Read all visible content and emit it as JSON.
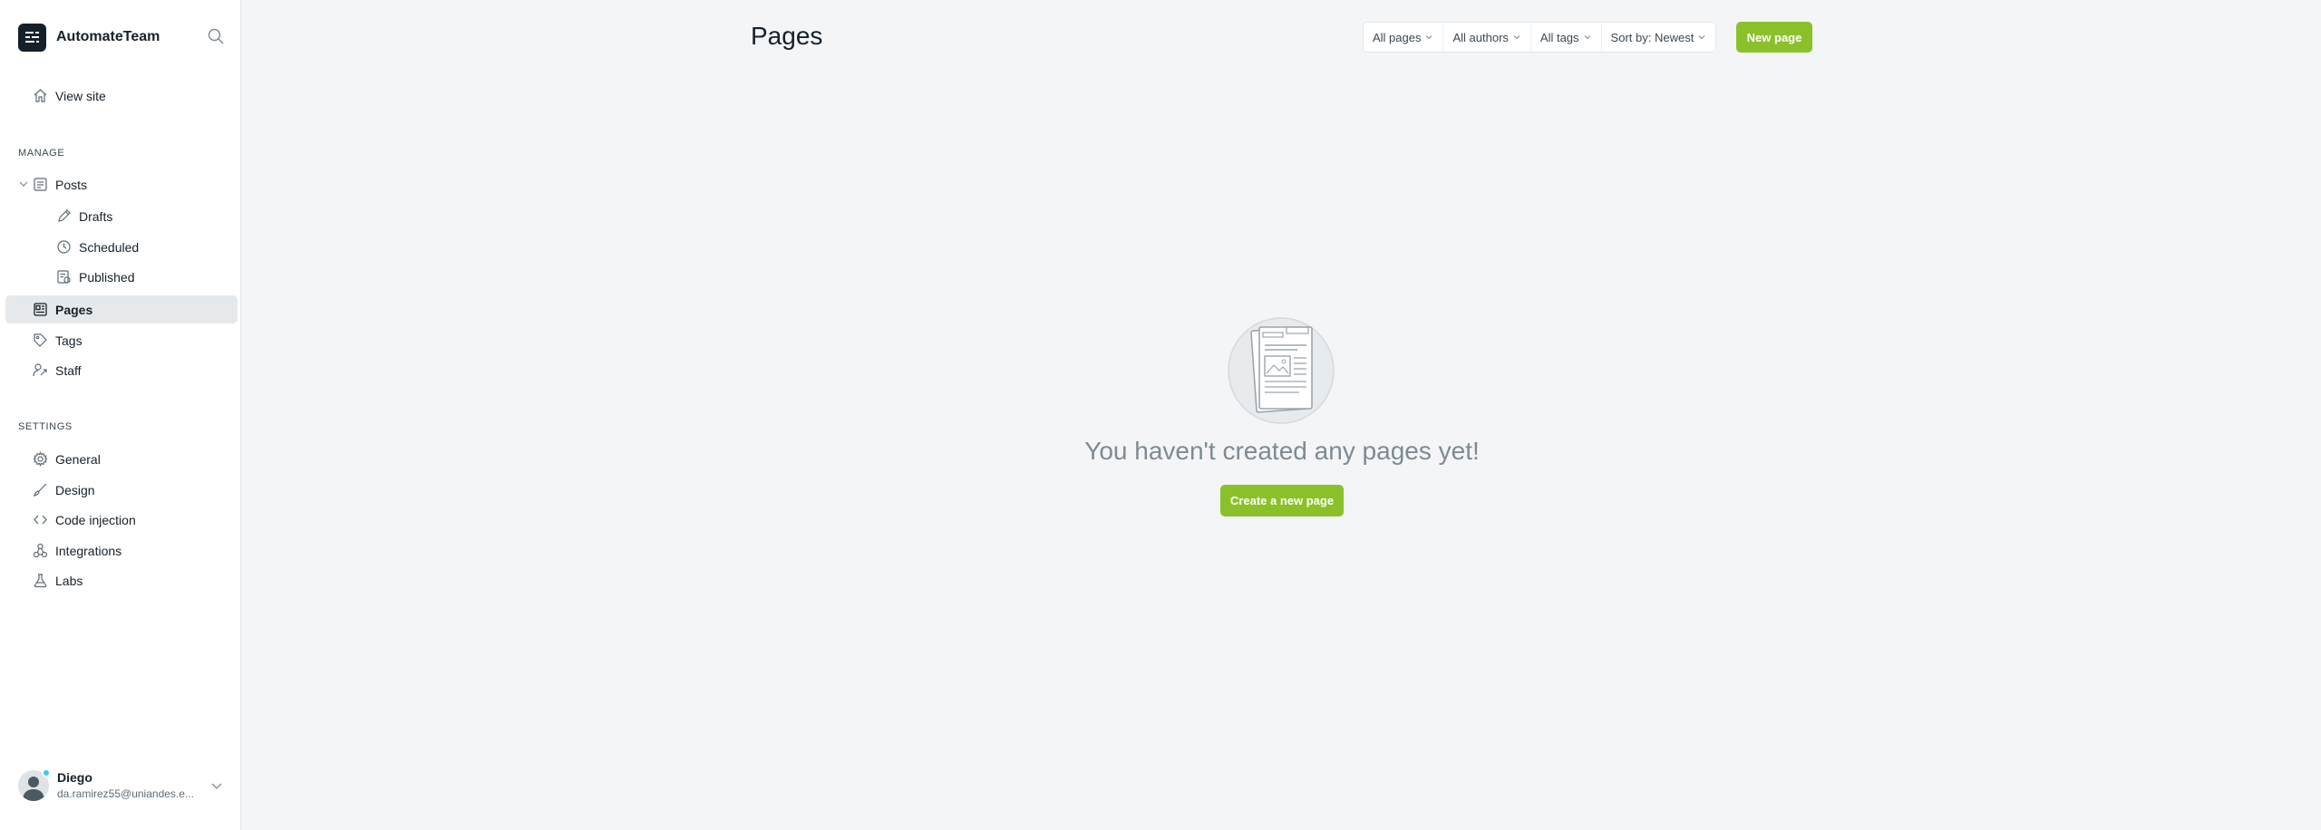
{
  "brand": {
    "name": "AutomateTeam"
  },
  "sidebar": {
    "view_site": "View site",
    "manage_heading": "MANAGE",
    "posts": "Posts",
    "drafts": "Drafts",
    "scheduled": "Scheduled",
    "published": "Published",
    "pages": "Pages",
    "tags": "Tags",
    "staff": "Staff",
    "settings_heading": "SETTINGS",
    "general": "General",
    "design": "Design",
    "code_injection": "Code injection",
    "integrations": "Integrations",
    "labs": "Labs"
  },
  "user": {
    "name": "Diego",
    "email": "da.ramirez55@uniandes.e..."
  },
  "header": {
    "title": "Pages",
    "filters": {
      "type": "All pages",
      "authors": "All authors",
      "tags": "All tags",
      "sort": "Sort by: Newest"
    },
    "new_page_label": "New page"
  },
  "empty_state": {
    "message": "You haven't created any pages yet!",
    "cta_label": "Create a new page"
  },
  "colors": {
    "accent": "#8ac12a",
    "sidebar_active": "#e6e9eb",
    "online": "#30cfee"
  }
}
